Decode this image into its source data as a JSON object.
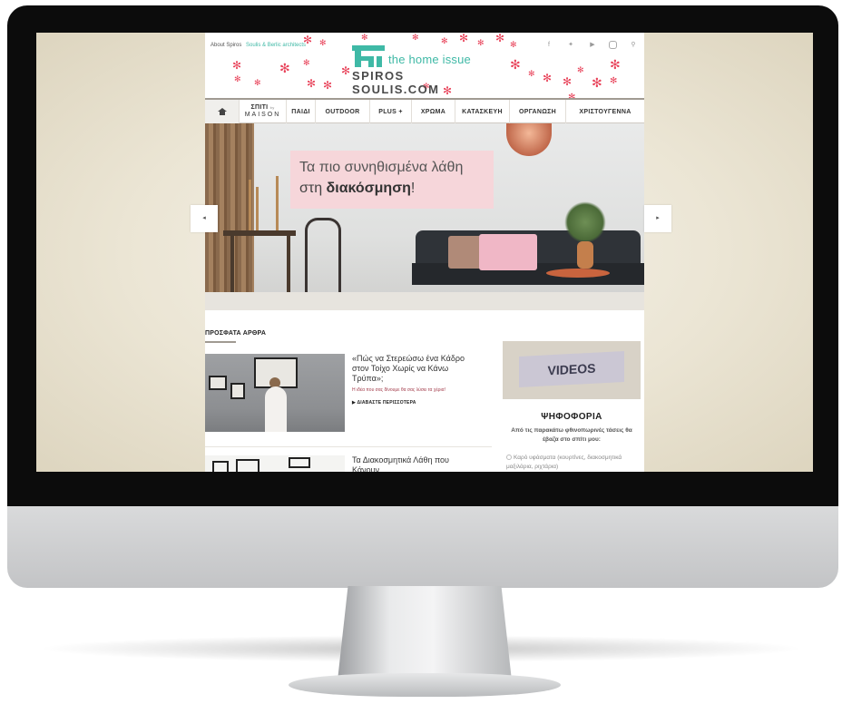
{
  "site": {
    "top_links": [
      "About Spiros",
      "Soulis & Berlic architects"
    ],
    "social_icons": [
      "facebook-icon",
      "twitter-icon",
      "youtube-icon",
      "instagram-icon",
      "search-icon"
    ],
    "logo": {
      "tagline": "the home issue",
      "brand": "SPIROS SOULIS.COM"
    },
    "accent_color": "#3fb9a6"
  },
  "nav": {
    "home_icon": "home-icon",
    "spiti": "ΣΠΙΤΙ",
    "spiti_by": "by",
    "spiti_maison": "MAISON",
    "items": [
      "ΠΑΙΔΙ",
      "OUTDOOR",
      "PLUS +",
      "ΧΡΩΜΑ",
      "ΚΑΤΑΣΚΕΥΗ",
      "ΟΡΓΑΝΩΣΗ",
      "ΧΡΙΣΤΟΥΓΕΝΝΑ"
    ]
  },
  "hero": {
    "line1": "Τα πιο συνηθισμένα λάθη",
    "line2_pre": "στη ",
    "line2_bold": "διακόσμηση",
    "line2_post": "!",
    "prev_icon": "◂",
    "next_icon": "▸"
  },
  "recent": {
    "heading": "ΠΡΟΣΦΑΤΑ ΑΡΘΡΑ",
    "articles": [
      {
        "title": "«Πώς να Στερεώσω ένα Κάδρο στον Τοίχο Χωρίς να Κάνω Τρύπα»;",
        "subtitle": "Η ιδέα που σας δίνουμε θα σας λύσει τα χέρια!",
        "more": "▶ ΔΙΑΒΑΣΤΕ ΠΕΡΙΣΣΟΤΕΡΑ"
      },
      {
        "title": "Τα Διακοσμητικά Λάθη που Κάνουν"
      }
    ]
  },
  "sidebar": {
    "videos": "VIDEOS",
    "poll_title": "ΨΗΦΟΦΟΡΙΑ",
    "poll_question": "Από τις παρακάτω φθινοπωρινές τάσεις θα έβαζα στο σπίτι μου:",
    "poll_option": "Καρό υφάσματα (κουρτίνες, διακοσμητικά μαξιλάρια, ριχτάρια)"
  }
}
